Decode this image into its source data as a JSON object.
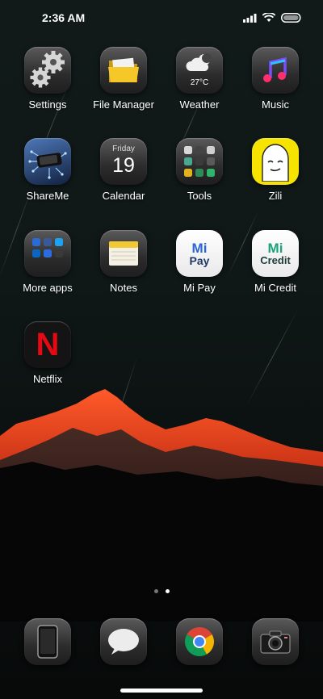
{
  "status_bar": {
    "time": "2:36 AM",
    "icons": [
      "signal-icon",
      "wifi-icon",
      "battery-icon"
    ]
  },
  "apps": [
    {
      "label": "Settings",
      "icon": "gears-icon"
    },
    {
      "label": "File Manager",
      "icon": "folder-icon"
    },
    {
      "label": "Weather",
      "icon": "cloud-moon-icon",
      "temp": "27°C"
    },
    {
      "label": "Music",
      "icon": "music-note-icon"
    },
    {
      "label": "ShareMe",
      "icon": "shareme-icon"
    },
    {
      "label": "Calendar",
      "icon": "calendar-icon",
      "day": "Friday",
      "date": "19"
    },
    {
      "label": "Tools",
      "icon": "tools-folder-icon"
    },
    {
      "label": "Zili",
      "icon": "zili-icon"
    },
    {
      "label": "More apps",
      "icon": "more-apps-folder-icon"
    },
    {
      "label": "Notes",
      "icon": "notes-icon"
    },
    {
      "label": "Mi Pay",
      "icon": "mi-pay-icon",
      "logo_line1": "Mi",
      "logo_line2": "Pay"
    },
    {
      "label": "Mi Credit",
      "icon": "mi-credit-icon",
      "logo_line1": "Mi",
      "logo_line2": "Credit"
    },
    {
      "label": "Netflix",
      "icon": "netflix-icon",
      "logo": "N"
    }
  ],
  "page_indicator": {
    "count": 2,
    "active": 1
  },
  "dock": [
    {
      "name": "phone",
      "icon": "phone-icon"
    },
    {
      "name": "messages",
      "icon": "message-bubble-icon"
    },
    {
      "name": "browser",
      "icon": "chrome-icon"
    },
    {
      "name": "camera",
      "icon": "camera-icon"
    }
  ],
  "colors": {
    "mountain": "#e03a1c",
    "mi_pay_blue": "#1f3a66",
    "mi_credit_green": "#1aa37a",
    "netflix_red": "#e50914",
    "zili_yellow": "#f6e400"
  }
}
